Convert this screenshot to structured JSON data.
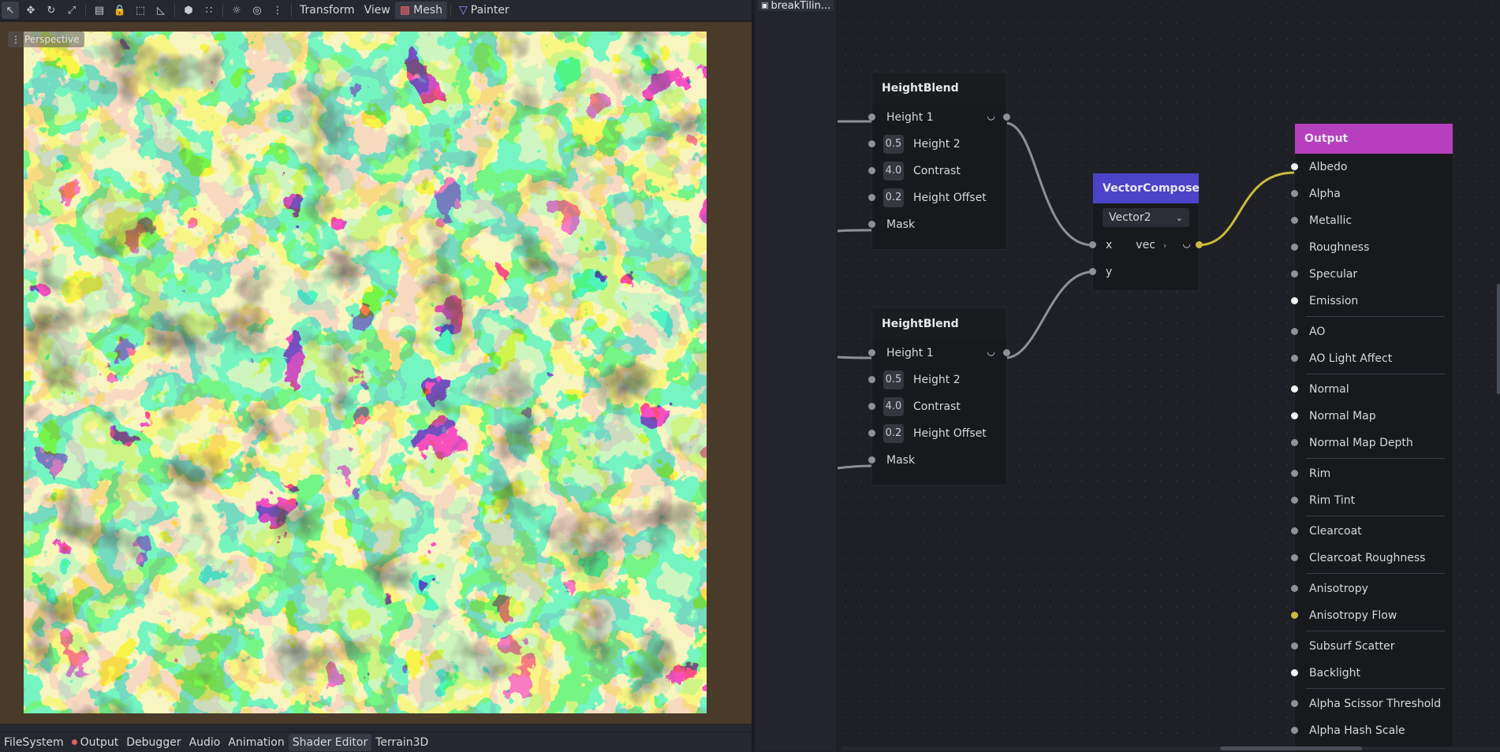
{
  "toolbar": {
    "transform_label": "Transform",
    "view_label": "View",
    "mesh_label": "Mesh",
    "painter_label": "Painter",
    "icons": [
      "select-icon",
      "move-icon",
      "rotate-icon",
      "scale-icon",
      "ruler-icon",
      "lock-icon",
      "group-icon",
      "angle-icon",
      "cube-icon",
      "snap-icon",
      "sun-icon",
      "globe-icon",
      "more-icon"
    ]
  },
  "viewport": {
    "perspective_label": "Perspective"
  },
  "bottom_tabs": {
    "filesystem": "FileSystem",
    "output": "Output",
    "debugger": "Debugger",
    "audio": "Audio",
    "animation": "Animation",
    "shader_editor": "Shader Editor",
    "terrain3d": "Terrain3D"
  },
  "file_tab": {
    "name": "breakTilin..."
  },
  "nodes": {
    "heightblend_top": {
      "title": "HeightBlend",
      "rows": {
        "height1": "Height 1",
        "height2": "Height 2",
        "height2_val": "0.5",
        "contrast": "Contrast",
        "contrast_val": "4.0",
        "offset": "Height Offset",
        "offset_val": "0.2",
        "mask": "Mask"
      }
    },
    "heightblend_bottom": {
      "title": "HeightBlend",
      "rows": {
        "height1": "Height 1",
        "height2": "Height 2",
        "height2_val": "0.5",
        "contrast": "Contrast",
        "contrast_val": "4.0",
        "offset": "Height Offset",
        "offset_val": "0.2",
        "mask": "Mask"
      }
    },
    "vectorcompose": {
      "title": "VectorCompose",
      "type_select": "Vector2",
      "x_label": "x",
      "vec_label": "vec",
      "y_label": "y",
      "header_color": "#4b43c8"
    },
    "output": {
      "title": "Output",
      "header_color": "#b53fbd",
      "albedo": "Albedo",
      "alpha": "Alpha",
      "metallic": "Metallic",
      "roughness": "Roughness",
      "specular": "Specular",
      "emission": "Emission",
      "ao": "AO",
      "ao_light": "AO Light Affect",
      "normal": "Normal",
      "normal_map": "Normal Map",
      "normal_map_depth": "Normal Map Depth",
      "rim": "Rim",
      "rim_tint": "Rim Tint",
      "clearcoat": "Clearcoat",
      "clearcoat_roughness": "Clearcoat Roughness",
      "anisotropy": "Anisotropy",
      "anisotropy_flow": "Anisotropy Flow",
      "subsurf": "Subsurf Scatter",
      "backlight": "Backlight",
      "alpha_scissor": "Alpha Scissor Threshold",
      "alpha_hash": "Alpha Hash Scale"
    }
  },
  "colors": {
    "texture_red": "#e0341f",
    "texture_yellow": "#f0e98a",
    "texture_green": "#9fe884",
    "texture_deep_green": "#2fb33a",
    "texture_black": "#151413",
    "wire_grey": "#8e9197",
    "wire_yellow": "#c8bb3e"
  }
}
